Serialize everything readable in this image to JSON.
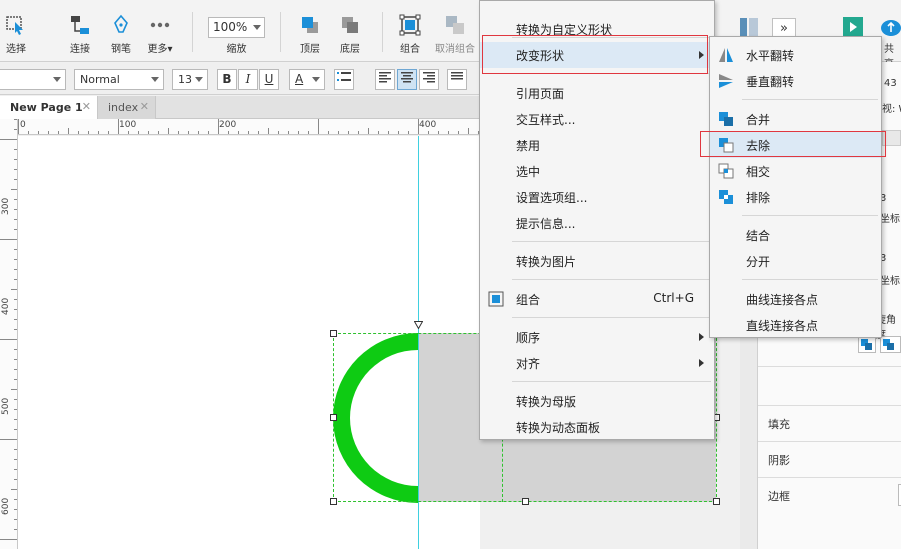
{
  "toolbar": {
    "select_label": "选择",
    "connect_label": "连接",
    "pen_label": "钢笔",
    "more_label": "更多▾",
    "zoom_value": "100%",
    "zoom_label": "缩放",
    "top_label": "顶层",
    "bottom_label": "底层",
    "group_label": "组合",
    "ungroup_label": "取消组合",
    "share_label": "共享"
  },
  "format": {
    "style_value": "Normal",
    "size_value": "13",
    "bold": "B",
    "italic": "I",
    "underline": "U",
    "font_color": "A"
  },
  "tabs": [
    {
      "label": "New Page 1"
    },
    {
      "label": "index"
    }
  ],
  "ruler_h": [
    "0",
    "100",
    "200",
    "400"
  ],
  "ruler_v": [
    "300",
    "400",
    "500",
    "600"
  ],
  "context_menu": {
    "items": [
      {
        "label": "转换为自定义形状"
      },
      {
        "label": "改变形状"
      },
      {
        "label": "引用页面"
      },
      {
        "label": "交互样式..."
      },
      {
        "label": "禁用"
      },
      {
        "label": "选中"
      },
      {
        "label": "设置选项组..."
      },
      {
        "label": "提示信息..."
      },
      {
        "label": "转换为图片"
      },
      {
        "label": "组合",
        "shortcut": "Ctrl+G"
      },
      {
        "label": "顺序"
      },
      {
        "label": "对齐"
      },
      {
        "label": "转换为母版"
      },
      {
        "label": "转换为动态面板"
      }
    ]
  },
  "submenu": {
    "items": [
      {
        "label": "水平翻转"
      },
      {
        "label": "垂直翻转"
      },
      {
        "label": "合并"
      },
      {
        "label": "去除"
      },
      {
        "label": "相交"
      },
      {
        "label": "排除"
      },
      {
        "label": "结合"
      },
      {
        "label": "分开"
      },
      {
        "label": "曲线连接各点"
      },
      {
        "label": "直线连接各点"
      }
    ]
  },
  "right_panel": {
    "fill_label": "填充",
    "shadow_label": "阴影",
    "border_label": "边框",
    "partial_texts": [
      "视: W",
      "43",
      "3",
      "坐标",
      "3",
      "坐标",
      "旋角度"
    ]
  },
  "colors": {
    "accent_blue": "#1b8fd8",
    "ring_green": "#0ecb13",
    "selection_green": "#2ec12e",
    "guide_cyan": "#3fd0e0",
    "highlight_red": "#e0373f",
    "shape_gray": "#d3d3d3"
  }
}
